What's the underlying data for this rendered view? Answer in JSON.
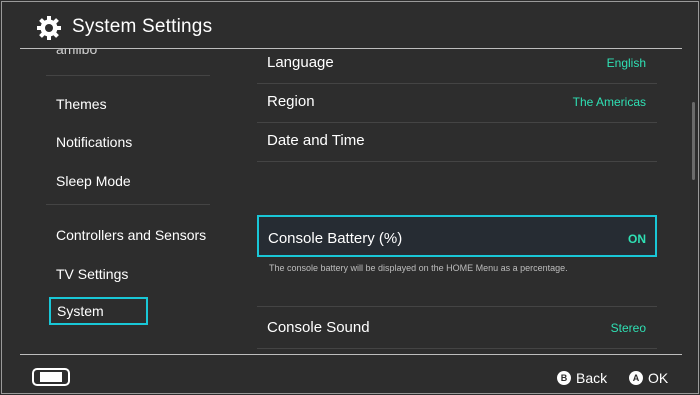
{
  "header": {
    "title": "System Settings",
    "icon": "gear-icon"
  },
  "sidebar": {
    "partial_item": "amiibo",
    "items": [
      {
        "label": "Themes"
      },
      {
        "label": "Notifications"
      },
      {
        "label": "Sleep Mode"
      },
      {
        "label": "Controllers and Sensors"
      },
      {
        "label": "TV Settings"
      },
      {
        "label": "System"
      }
    ],
    "selected_index": 5
  },
  "main": {
    "rows": [
      {
        "label": "Language",
        "value": "English"
      },
      {
        "label": "Region",
        "value": "The Americas"
      },
      {
        "label": "Date and Time",
        "value": ""
      },
      {
        "label": "Console Battery (%)",
        "value": "ON"
      },
      {
        "label": "Console Sound",
        "value": "Stereo"
      }
    ],
    "battery_description": "The console battery will be displayed on the HOME Menu as a percentage."
  },
  "footer": {
    "back": {
      "key": "B",
      "label": "Back"
    },
    "ok": {
      "key": "A",
      "label": "OK"
    }
  },
  "colors": {
    "accent": "#19c7d7",
    "value_text": "#2fe0b4",
    "background": "#2d2d2d"
  }
}
